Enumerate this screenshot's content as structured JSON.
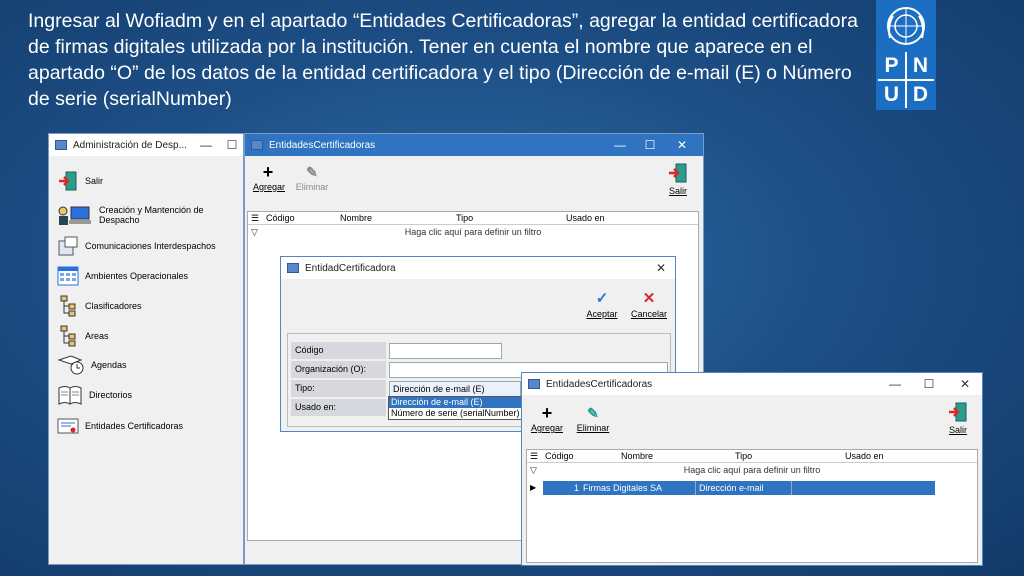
{
  "slide": {
    "text": "Ingresar al Wofiadm y en el apartado “Entidades Certificadoras”, agregar la entidad certificadora de firmas digitales utilizada por la institución. Tener en cuenta el nombre que aparece en el apartado “O” de los datos de la entidad certificadora y el tipo (Dirección de e-mail (E) o Número de serie (serialNumber)"
  },
  "logo": {
    "letters": [
      "P",
      "N",
      "U",
      "D"
    ]
  },
  "admin_window": {
    "title": "Administración de Desp...",
    "salir": "Salir",
    "items": [
      "Creación y Mantención de Despacho",
      "Comunicaciones Interdespachos",
      "Ambientes Operacionales",
      "Clasificadores",
      "Areas",
      "Agendas",
      "Directorios",
      "Entidades Certificadoras"
    ]
  },
  "ent_back": {
    "title": "EntidadesCertificadoras",
    "agregar": "Agregar",
    "eliminar": "Eliminar",
    "salir": "Salir",
    "columns": [
      "Código",
      "Nombre",
      "Tipo",
      "Usado en"
    ],
    "filter_hint": "Haga clic aquí para definir un filtro"
  },
  "dialog": {
    "title": "EntidadCertificadora",
    "aceptar": "Aceptar",
    "cancelar": "Cancelar",
    "codigo_label": "Código",
    "organizacion_label": "Organización (O):",
    "tipo_label": "Tipo:",
    "usado_label": "Usado en:",
    "tipo_value": "Dirección de e-mail (E)",
    "options": [
      "Dirección de e-mail (E)",
      "Número de serie (serialNumber)"
    ]
  },
  "ent_front": {
    "title": "EntidadesCertificadoras",
    "agregar": "Agregar",
    "eliminar": "Eliminar",
    "salir": "Salir",
    "columns": [
      "Código",
      "Nombre",
      "Tipo",
      "Usado en"
    ],
    "filter_hint": "Haga clic aquí para definir un filtro",
    "row": {
      "codigo": "1",
      "nombre": "Firmas Digitales SA",
      "tipo": "Dirección e-mail"
    }
  }
}
